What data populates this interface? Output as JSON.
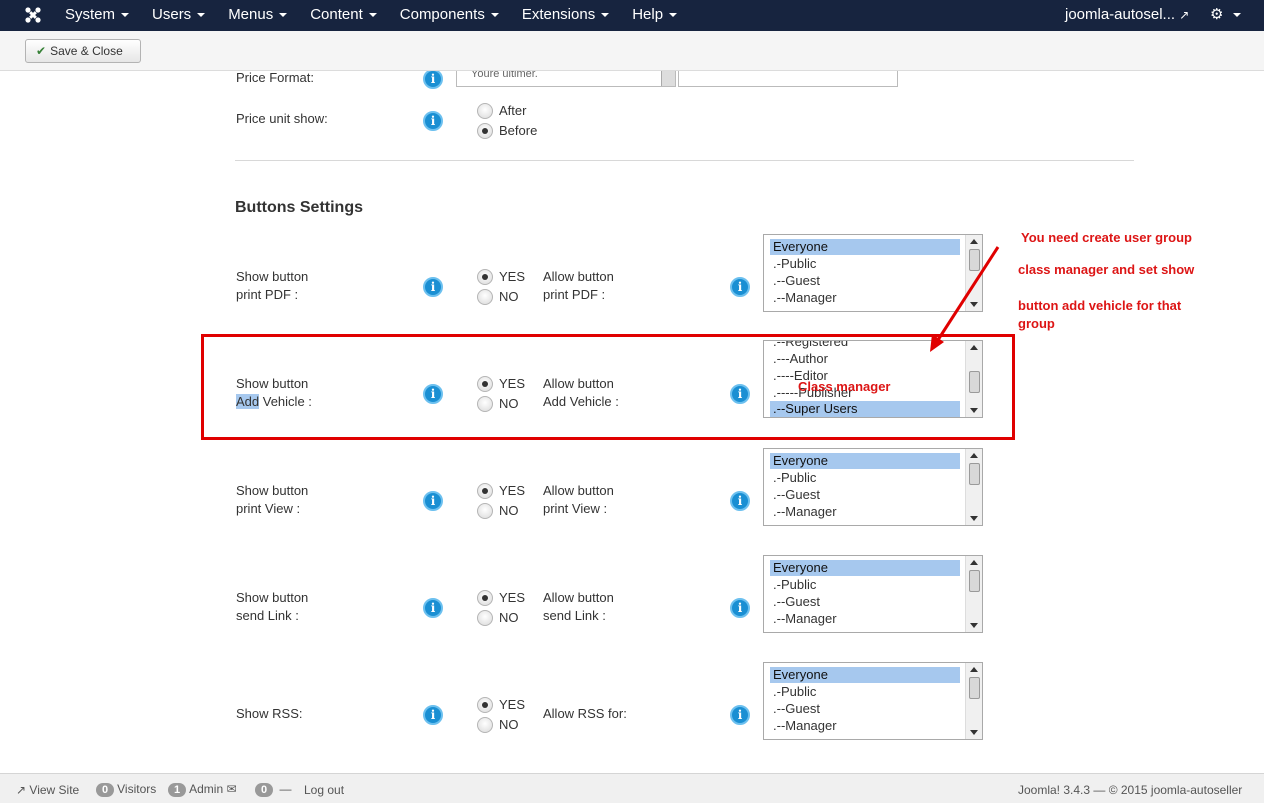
{
  "navbar": {
    "logo_icon": "joomla-logo-icon",
    "menus": [
      "System",
      "Users",
      "Menus",
      "Content",
      "Components",
      "Extensions",
      "Help"
    ],
    "site_link": "joomla-autosel...",
    "gear_icon": "gear-icon"
  },
  "toolbar": {
    "save_close_label": "Save & Close"
  },
  "form": {
    "price_format_label": "Price Format:",
    "price_format_select": "Youre ultimer.",
    "price_unit_label": "Price unit show:",
    "price_unit_options": [
      "After",
      "Before"
    ],
    "price_unit_selected": "Before",
    "buttons_heading": "Buttons Settings",
    "rows": [
      {
        "show_label_1": "Show button",
        "show_label_2": "print PDF :",
        "yes": "YES",
        "no": "NO",
        "selected": "YES",
        "allow_label_1": "Allow button",
        "allow_label_2": "print PDF :",
        "list": [
          "Everyone",
          ".-Public",
          ".--Guest",
          ".--Manager"
        ],
        "list_selected": "Everyone"
      },
      {
        "show_label_1": "Show button",
        "show_label_2a": "Add",
        "show_label_2b": " Vehicle :",
        "yes": "YES",
        "no": "NO",
        "selected": "YES",
        "allow_label_1": "Allow button",
        "allow_label_2": "Add Vehicle :",
        "list": [
          ".--Registered",
          ".---Author",
          ".----Editor",
          ".-----Publisher",
          ".--Super Users"
        ],
        "list_selected": ".--Super Users"
      },
      {
        "show_label_1": "Show button",
        "show_label_2": "print View :",
        "yes": "YES",
        "no": "NO",
        "selected": "YES",
        "allow_label_1": "Allow button",
        "allow_label_2": "print View :",
        "list": [
          "Everyone",
          ".-Public",
          ".--Guest",
          ".--Manager"
        ],
        "list_selected": "Everyone"
      },
      {
        "show_label_1": "Show button",
        "show_label_2": "send Link :",
        "yes": "YES",
        "no": "NO",
        "selected": "YES",
        "allow_label_1": "Allow button",
        "allow_label_2": "send Link :",
        "list": [
          "Everyone",
          ".-Public",
          ".--Guest",
          ".--Manager"
        ],
        "list_selected": "Everyone"
      },
      {
        "show_label_1": "Show RSS:",
        "yes": "YES",
        "no": "NO",
        "selected": "YES",
        "allow_label_1": "Allow RSS for:",
        "list": [
          "Everyone",
          ".-Public",
          ".--Guest",
          ".--Manager"
        ],
        "list_selected": "Everyone"
      }
    ]
  },
  "annotation": {
    "line1": "You need create user group",
    "line2": "class manager and set show",
    "line3": "button add vehicle for that",
    "line4": "group",
    "class_manager": "Class manager",
    "color": "#dd1515"
  },
  "footer": {
    "view_site": "View Site",
    "visitors_count": "0",
    "visitors_label": "Visitors",
    "admin_count": "1",
    "admin_label": "Admin",
    "messages_count": "0",
    "logout": "Log out",
    "version": "Joomla! 3.4.3 — © 2015 joomla-autoseller"
  }
}
